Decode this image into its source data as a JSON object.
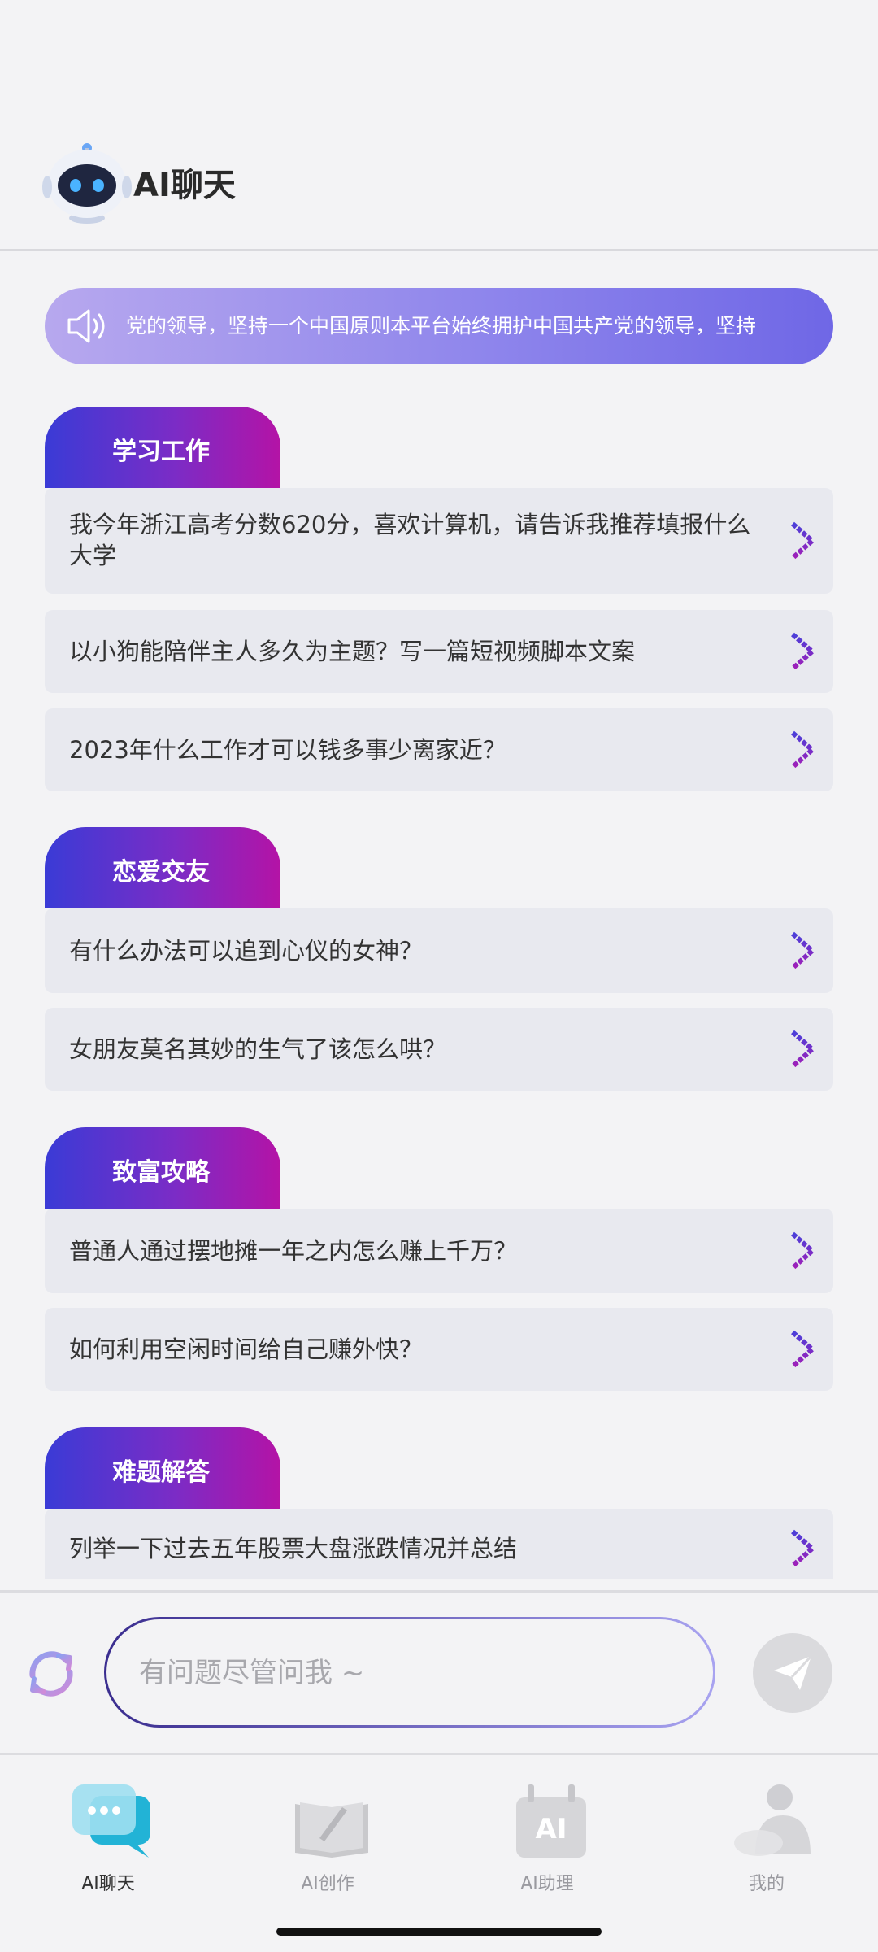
{
  "header": {
    "title": "AI聊天",
    "logo": "robot-logo"
  },
  "notice": {
    "icon": "speaker-icon",
    "text": "党的领导，坚持一个中国原则本平台始终拥护中国共产党的领导，坚持"
  },
  "sections": [
    {
      "label": "学习工作",
      "items": [
        "我今年浙江高考分数620分，喜欢计算机，请告诉我推荐填报什么大学",
        "以小狗能陪伴主人多久为主题？写一篇短视频脚本文案",
        "2023年什么工作才可以钱多事少离家近？"
      ]
    },
    {
      "label": "恋爱交友",
      "items": [
        "有什么办法可以追到心仪的女神？",
        "女朋友莫名其妙的生气了该怎么哄？"
      ]
    },
    {
      "label": "致富攻略",
      "items": [
        "普通人通过摆地摊一年之内怎么赚上千万？",
        "如何利用空闲时间给自己赚外快？"
      ]
    },
    {
      "label": "难题解答",
      "items": [
        "列举一下过去五年股票大盘涨跌情况并总结"
      ]
    }
  ],
  "input": {
    "placeholder": "有问题尽管问我 ~",
    "value": ""
  },
  "nav": [
    {
      "label": "AI聊天",
      "icon": "chat-bubble-icon",
      "active": true
    },
    {
      "label": "AI创作",
      "icon": "book-pen-icon",
      "active": false
    },
    {
      "label": "AI助理",
      "icon": "ai-assistant-icon",
      "active": false
    },
    {
      "label": "我的",
      "icon": "user-profile-icon",
      "active": false
    }
  ],
  "colors": {
    "accent_start": "#3a3bd6",
    "accent_end": "#b413a6",
    "notice": "#8f86ec"
  }
}
